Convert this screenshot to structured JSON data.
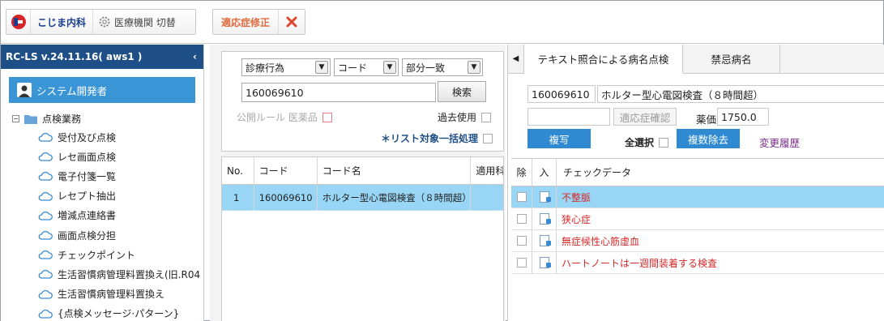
{
  "toolbar": {
    "clinic_name": "こじま内科",
    "switch_label": "医療機関 切替",
    "fix_label": "適応症修正"
  },
  "sidebar": {
    "version": "RC-LS v.24.11.16( aws1 )",
    "user": "システム開発者",
    "root": "点検業務",
    "items": [
      "受付及び点検",
      "レセ画面点検",
      "電子付箋一覧",
      "レセプト抽出",
      "増減点連絡書",
      "画面点検分担",
      "チェックポイント",
      "生活習慣病管理料置換え(旧.R04",
      "生活習慣病管理料置換え",
      "{点検メッセージ·パターン}"
    ]
  },
  "search": {
    "select1": "診療行為",
    "select2": "コード",
    "select3": "部分一致",
    "code_value": "160069610",
    "search_button": "検索",
    "public_rule": "公開ルール 医薬品",
    "past_use": "過去使用",
    "batch": "＊リスト対象一括処理"
  },
  "result_grid": {
    "headers": [
      "No.",
      "コード",
      "コード名",
      "適用科"
    ],
    "rows": [
      {
        "no": "1",
        "code": "160069610",
        "name": "ホルター型心電図検査（８時間超）",
        "extra": ""
      }
    ]
  },
  "right_panel": {
    "tab_active": "テキスト照合による病名点検",
    "tab_inactive": "禁忌病名",
    "code": "160069610",
    "name": "ホルター型心電図検査（８時間超）",
    "input_placeholder": "",
    "confirm_button": "適応症確認",
    "price_label": "薬価",
    "price_value": "1750.0",
    "copy_button": "複写",
    "select_all": "全選択",
    "multi_remove": "複数除去",
    "history_link": "変更履歴",
    "check_headers": [
      "除",
      "入",
      "チェックデータ"
    ],
    "check_rows": [
      "不整脈",
      "狭心症",
      "無症候性心筋虚血",
      "ハートノートは一週間装着する検査"
    ]
  }
}
